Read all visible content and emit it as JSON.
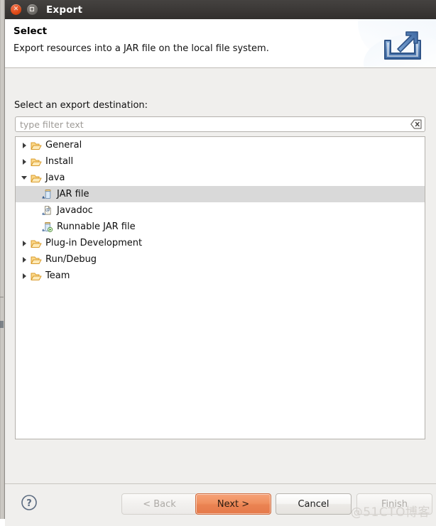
{
  "window": {
    "title": "Export",
    "close_icon": "close-icon",
    "maximize_icon": "maximize-icon"
  },
  "banner": {
    "title": "Select",
    "description": "Export resources into a JAR file on the local file system.",
    "icon": "export-wizard-icon"
  },
  "main": {
    "destination_label": "Select an export destination:",
    "filter": {
      "value": "",
      "placeholder": "type filter text",
      "clear_icon": "clear-filter-icon"
    },
    "tree": [
      {
        "label": "General",
        "icon": "folder-icon",
        "level": 0,
        "expanded": false,
        "selected": false,
        "has_children": true
      },
      {
        "label": "Install",
        "icon": "folder-icon",
        "level": 0,
        "expanded": false,
        "selected": false,
        "has_children": true
      },
      {
        "label": "Java",
        "icon": "folder-icon",
        "level": 0,
        "expanded": true,
        "selected": false,
        "has_children": true
      },
      {
        "label": "JAR file",
        "icon": "jar-file-icon",
        "level": 1,
        "expanded": false,
        "selected": true,
        "has_children": false
      },
      {
        "label": "Javadoc",
        "icon": "javadoc-icon",
        "level": 1,
        "expanded": false,
        "selected": false,
        "has_children": false
      },
      {
        "label": "Runnable JAR file",
        "icon": "runnable-jar-icon",
        "level": 1,
        "expanded": false,
        "selected": false,
        "has_children": false
      },
      {
        "label": "Plug-in Development",
        "icon": "folder-icon",
        "level": 0,
        "expanded": false,
        "selected": false,
        "has_children": true
      },
      {
        "label": "Run/Debug",
        "icon": "folder-icon",
        "level": 0,
        "expanded": false,
        "selected": false,
        "has_children": true
      },
      {
        "label": "Team",
        "icon": "folder-icon",
        "level": 0,
        "expanded": false,
        "selected": false,
        "has_children": true
      }
    ]
  },
  "buttons": {
    "help_icon": "help-icon",
    "back": {
      "label": "< Back",
      "enabled": false,
      "primary": false
    },
    "next": {
      "label": "Next >",
      "enabled": true,
      "primary": true
    },
    "cancel": {
      "label": "Cancel",
      "enabled": true,
      "primary": false
    },
    "finish": {
      "label": "Finish",
      "enabled": false,
      "primary": false
    }
  },
  "watermark": "@51CTO博客",
  "colors": {
    "accent": "#ea8352",
    "titlebar": "#3b3836",
    "dialog_bg": "#f0efed",
    "selection": "#d9d9d9",
    "folder": "#f0a93b"
  }
}
